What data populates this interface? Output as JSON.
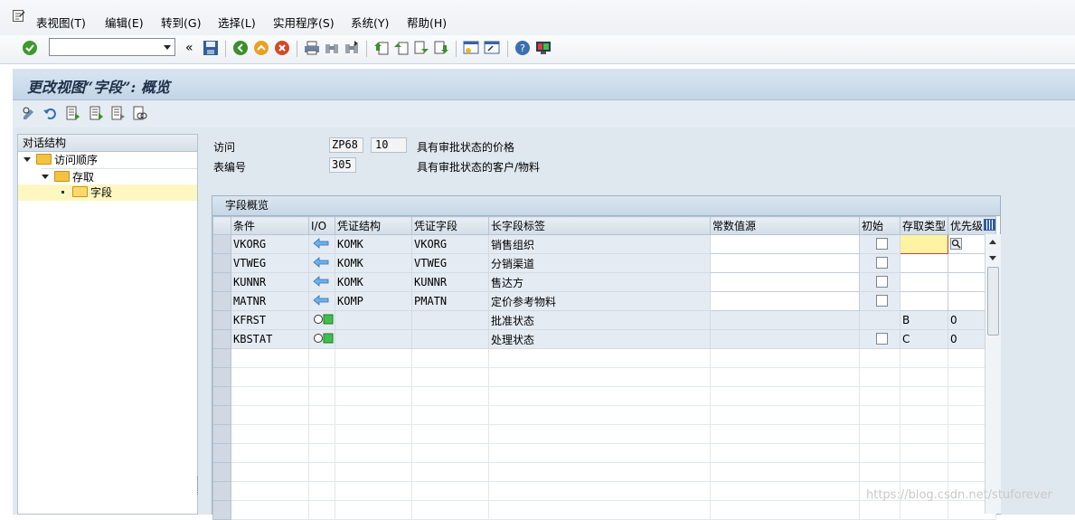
{
  "menu": {
    "items": [
      "表视图(T)",
      "编辑(E)",
      "转到(G)",
      "选择(L)",
      "实用程序(S)",
      "系统(Y)",
      "帮助(H)"
    ]
  },
  "toolbar": {
    "command_field_value": "",
    "icons": [
      "enter-check-icon",
      "save-icon",
      "back-icon",
      "exit-icon",
      "cancel-icon",
      "print-icon",
      "find-icon",
      "find-next-icon",
      "first-page-icon",
      "previous-page-icon",
      "next-page-icon",
      "last-page-icon",
      "create-session-icon",
      "shortcut-icon",
      "help-icon",
      "layout-icon"
    ]
  },
  "title": "更改视图“字段”: 概览",
  "app_toolbar": {
    "icons": [
      "display-change-icon",
      "undo-icon",
      "new-entries-icon",
      "copy-as-icon",
      "delete-icon",
      "select-all-icon"
    ]
  },
  "tree": {
    "header": "对话结构",
    "nodes": [
      {
        "label": "访问顺序",
        "level": 0,
        "expanded": true
      },
      {
        "label": "存取",
        "level": 1,
        "expanded": true
      },
      {
        "label": "字段",
        "level": 2,
        "selected": true
      }
    ]
  },
  "header_fields": {
    "access_label": "访问",
    "access_value": "ZP68",
    "access_seq": "10",
    "access_desc": "具有审批状态的价格",
    "table_label": "表编号",
    "table_value": "305",
    "table_desc": "具有审批状态的客户/物料"
  },
  "panel_title": "字段概览",
  "columns": [
    "条件",
    "I/O",
    "凭证结构",
    "凭证字段",
    "长字段标签",
    "常数值源",
    "初始",
    "存取类型",
    "优先级"
  ],
  "rows": [
    {
      "cond": "VKORG",
      "io": "arrow",
      "struct": "KOMK",
      "field": "VKORG",
      "label": "销售组织",
      "const": "",
      "init": true,
      "type": "",
      "prio": ""
    },
    {
      "cond": "VTWEG",
      "io": "arrow",
      "struct": "KOMK",
      "field": "VTWEG",
      "label": "分销渠道",
      "const": "",
      "init": true,
      "type": "",
      "prio": ""
    },
    {
      "cond": "KUNNR",
      "io": "arrow",
      "struct": "KOMK",
      "field": "KUNNR",
      "label": "售达方",
      "const": "",
      "init": true,
      "type": "",
      "prio": ""
    },
    {
      "cond": "MATNR",
      "io": "arrow",
      "struct": "KOMP",
      "field": "PMATN",
      "label": "定价参考物料",
      "const": "",
      "init": true,
      "type": "",
      "prio": ""
    },
    {
      "cond": "KFRST",
      "io": "const",
      "struct": "",
      "field": "",
      "label": "批准状态",
      "const": "",
      "init": false,
      "type": "B",
      "prio": "0"
    },
    {
      "cond": "KBSTAT",
      "io": "const",
      "struct": "",
      "field": "",
      "label": "处理状态",
      "const": "",
      "init": true,
      "type": "C",
      "prio": "0"
    }
  ],
  "empty_rows": 9,
  "watermark": "https://blog.csdn.net/stuforever"
}
